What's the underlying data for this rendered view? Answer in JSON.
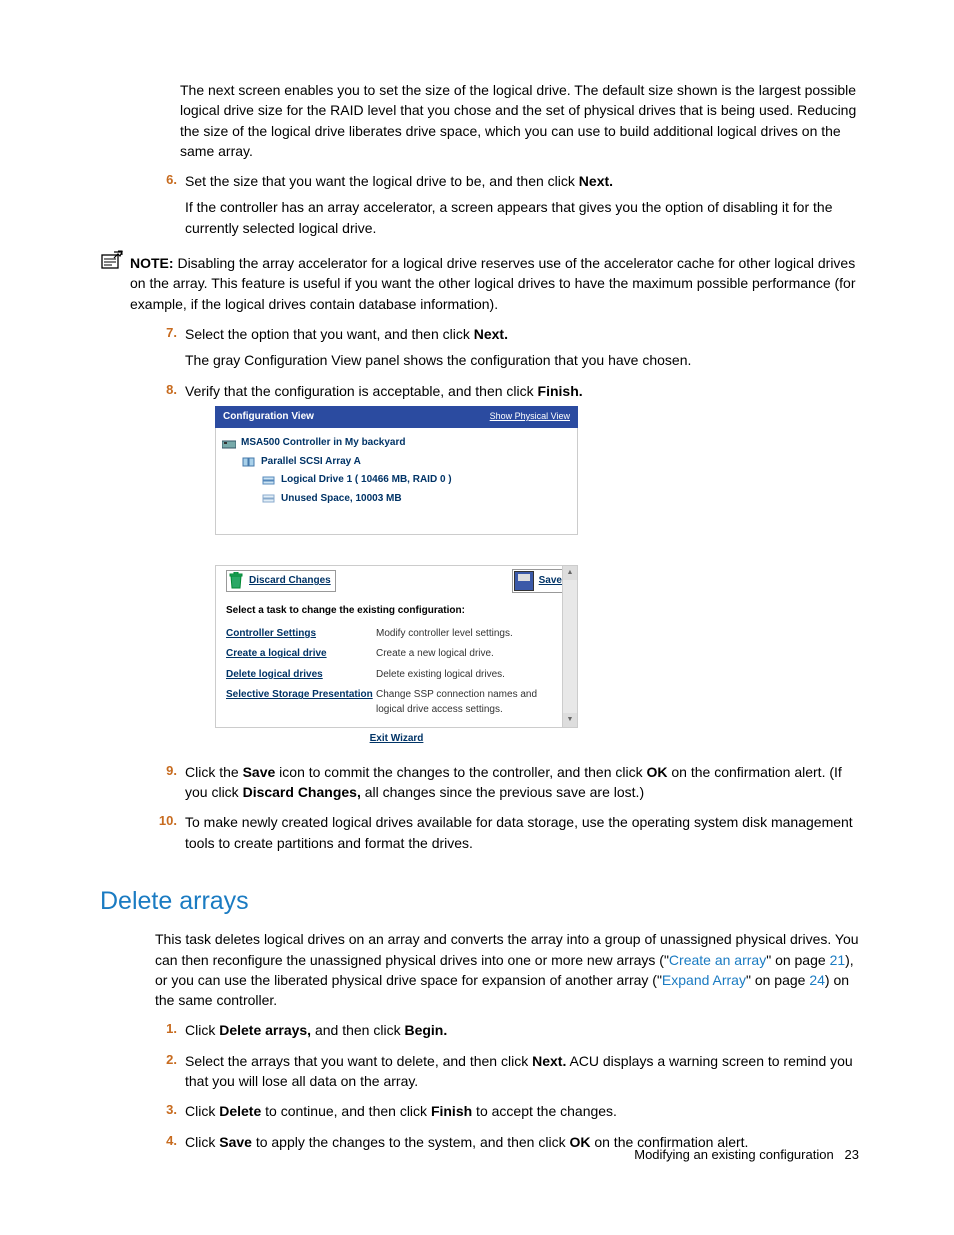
{
  "intro_para": "The next screen enables you to set the size of the logical drive. The default size shown is the largest possible logical drive size for the RAID level that you chose and the set of physical drives that is being used. Reducing the size of the logical drive liberates drive space, which you can use to build additional logical drives on the same array.",
  "step6_a": "Set the size that you want the logical drive to be, and then click ",
  "step6_b": "Next.",
  "step6_para": "If the controller has an array accelerator, a screen appears that gives you the option of disabling it for the currently selected logical drive.",
  "note_label": "NOTE:",
  "note_text": " Disabling the array accelerator for a logical drive reserves use of the accelerator cache for other logical drives on the array. This feature is useful if you want the other logical drives to have the maximum possible performance (for example, if the logical drives contain database information).",
  "step7_a": "Select the option that you want, and then click ",
  "step7_b": "Next.",
  "step7_para": "The gray Configuration View panel shows the configuration that you have chosen.",
  "step8_a": "Verify that the configuration is acceptable, and then click ",
  "step8_b": "Finish.",
  "screenshot": {
    "header_left": "Configuration View",
    "header_right": "Show Physical View",
    "tree": {
      "l1": "MSA500 Controller in My backyard",
      "l2": "Parallel SCSI Array A",
      "l3a": "Logical Drive 1 ( 10466 MB, RAID 0 )",
      "l3b": "Unused Space, 10003 MB"
    },
    "discard_btn": "Discard Changes",
    "save_btn": "Save",
    "task_label": "Select a task to change the existing configuration:",
    "tasks": [
      {
        "name": "Controller Settings",
        "desc": "Modify controller level settings."
      },
      {
        "name": "Create a logical drive",
        "desc": "Create a new logical drive."
      },
      {
        "name": "Delete logical drives",
        "desc": "Delete existing logical drives."
      },
      {
        "name": "Selective Storage Presentation",
        "desc": "Change SSP connection names and logical drive access settings."
      }
    ],
    "exit": "Exit Wizard"
  },
  "step9_a": "Click the ",
  "step9_b": "Save",
  "step9_c": " icon to commit the changes to the controller, and then click ",
  "step9_d": "OK",
  "step9_e": " on the confirmation alert. (If you click ",
  "step9_f": "Discard Changes,",
  "step9_g": " all changes since the previous save are lost.)",
  "step10": "To make newly created logical drives available for data storage, use the operating system disk management tools to create partitions and format the drives.",
  "section_title": "Delete arrays",
  "del_para_a": "This task deletes logical drives on an array and converts the array into a group of unassigned physical drives. You can then reconfigure the unassigned physical drives into one or more new arrays (\"",
  "del_link1": "Create an array",
  "del_para_b": "\" on page ",
  "del_pg1": "21",
  "del_para_c": "), or you can use the liberated physical drive space for expansion of another array (\"",
  "del_link2": "Expand Array",
  "del_para_d": "\" on page ",
  "del_pg2": "24",
  "del_para_e": ") on the same controller.",
  "dstep1_a": "Click ",
  "dstep1_b": "Delete arrays,",
  "dstep1_c": " and then click ",
  "dstep1_d": "Begin.",
  "dstep2_a": "Select the arrays that you want to delete, and then click ",
  "dstep2_b": "Next.",
  "dstep2_c": " ACU displays a warning screen to remind you that you will lose all data on the array.",
  "dstep3_a": "Click ",
  "dstep3_b": "Delete",
  "dstep3_c": " to continue, and then click ",
  "dstep3_d": "Finish",
  "dstep3_e": " to accept the changes.",
  "dstep4_a": "Click ",
  "dstep4_b": "Save",
  "dstep4_c": " to apply the changes to the system, and then click ",
  "dstep4_d": "OK",
  "dstep4_e": " on the confirmation alert.",
  "footer_text": "Modifying an existing configuration",
  "footer_page": "23",
  "nums": {
    "n6": "6.",
    "n7": "7.",
    "n8": "8.",
    "n9": "9.",
    "n10": "10.",
    "d1": "1.",
    "d2": "2.",
    "d3": "3.",
    "d4": "4."
  }
}
